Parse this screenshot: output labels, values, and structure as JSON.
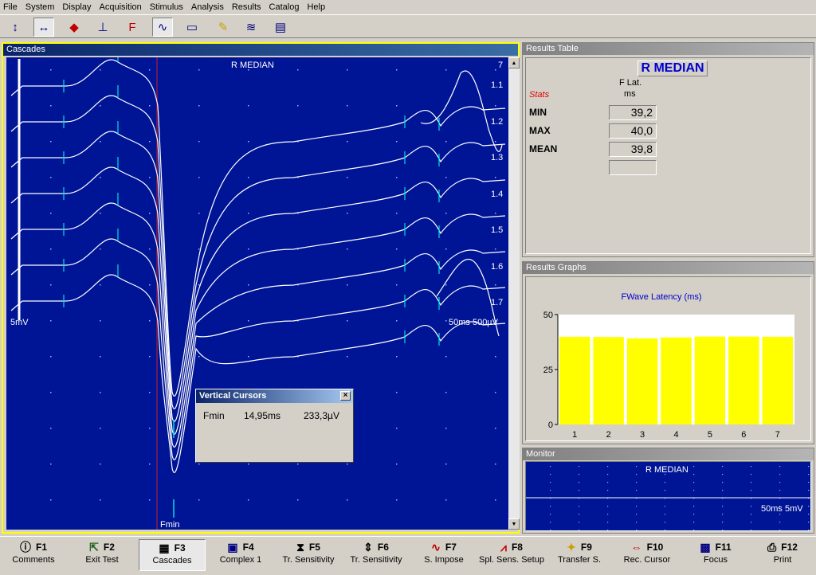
{
  "menu": [
    "File",
    "System",
    "Display",
    "Acquisition",
    "Stimulus",
    "Analysis",
    "Results",
    "Catalog",
    "Help"
  ],
  "menu_underline": [
    0,
    0,
    0,
    0,
    1,
    0,
    0,
    0,
    0
  ],
  "toolbar": [
    {
      "name": "amplitude-cursor-icon",
      "glyph": "↕",
      "pressed": false
    },
    {
      "name": "horizontal-cursor-icon",
      "glyph": "↔",
      "pressed": true
    },
    {
      "name": "latency-marker-icon",
      "glyph": "◆",
      "pressed": false
    },
    {
      "name": "onset-marker-icon",
      "glyph": "⊥",
      "pressed": false
    },
    {
      "name": "f-marker-icon",
      "glyph": "F",
      "pressed": false
    },
    {
      "name": "waveform-icon",
      "glyph": "∿",
      "pressed": true
    },
    {
      "name": "window-icon",
      "glyph": "▭",
      "pressed": false
    },
    {
      "name": "marker-pen-icon",
      "glyph": "✎",
      "pressed": false
    },
    {
      "name": "wave-edit-icon",
      "glyph": "≋",
      "pressed": false
    },
    {
      "name": "report-icon",
      "glyph": "▤",
      "pressed": false
    }
  ],
  "cascades": {
    "title": "Cascades",
    "nerve_label": "R MEDIAN",
    "top_number": "7",
    "sensitivity_label": "5mV",
    "scale_label": "50ms 500µV",
    "cursor_label": "Fmin",
    "trace_labels": [
      "1.1",
      "1.2",
      "1.3",
      "1.4",
      "1.5",
      "1.6",
      "1.7"
    ]
  },
  "vertical_cursors": {
    "title": "Vertical Cursors",
    "close": "×",
    "label": "Fmin",
    "time": "14,95ms",
    "amplitude": "233,3µV"
  },
  "results_table": {
    "title": "Results Table",
    "nerve": "R MEDIAN",
    "col_header_line1": "F Lat.",
    "col_header_line2": "ms",
    "stats_label": "Stats",
    "rows": [
      {
        "label": "MIN",
        "value": "39,2"
      },
      {
        "label": "MAX",
        "value": "40,0"
      },
      {
        "label": "MEAN",
        "value": "39,8"
      },
      {
        "label": "",
        "value": ""
      }
    ]
  },
  "results_graphs": {
    "title": "Results Graphs",
    "chart_title": "FWave Latency (ms)",
    "y_ticks": [
      "50",
      "25",
      "0"
    ],
    "bar_color": "#ffff00"
  },
  "chart_data": {
    "type": "bar",
    "title": "FWave Latency (ms)",
    "categories": [
      "1",
      "2",
      "3",
      "4",
      "5",
      "6",
      "7"
    ],
    "values": [
      39.9,
      39.8,
      39.2,
      39.6,
      40.0,
      40.0,
      39.9
    ],
    "ylim": [
      0,
      50
    ],
    "xlabel": "",
    "ylabel": ""
  },
  "monitor": {
    "title": "Monitor",
    "nerve": "R MEDIAN",
    "scale": "50ms 5mV"
  },
  "fkeys": [
    {
      "key": "F1",
      "label": "Comments",
      "icon": "comment-icon",
      "glyph": "ⓘ",
      "pressed": false
    },
    {
      "key": "F2",
      "label": "Exit Test",
      "icon": "exit-test-icon",
      "glyph": "⇱",
      "pressed": false
    },
    {
      "key": "F3",
      "label": "Cascades",
      "icon": "cascades-icon",
      "glyph": "▦",
      "pressed": true
    },
    {
      "key": "F4",
      "label": "Complex 1",
      "icon": "complex-icon",
      "glyph": "▣",
      "pressed": false
    },
    {
      "key": "F5",
      "label": "Tr. Sensitivity",
      "icon": "sensitivity-up-icon",
      "glyph": "⧗",
      "pressed": false
    },
    {
      "key": "F6",
      "label": "Tr. Sensitivity",
      "icon": "sensitivity-down-icon",
      "glyph": "⇕",
      "pressed": false
    },
    {
      "key": "F7",
      "label": "S. Impose",
      "icon": "superimpose-icon",
      "glyph": "∿",
      "pressed": false
    },
    {
      "key": "F8",
      "label": "Spl. Sens. Setup",
      "icon": "sens-setup-icon",
      "glyph": "⩘",
      "pressed": false
    },
    {
      "key": "F9",
      "label": "Transfer S.",
      "icon": "transfer-icon",
      "glyph": "✦",
      "pressed": false
    },
    {
      "key": "F10",
      "label": "Rec. Cursor",
      "icon": "rec-cursor-icon",
      "glyph": "⇔",
      "pressed": false
    },
    {
      "key": "F11",
      "label": "Focus",
      "icon": "focus-icon",
      "glyph": "▩",
      "pressed": false
    },
    {
      "key": "F12",
      "label": "Print",
      "icon": "print-icon",
      "glyph": "⎙",
      "pressed": false
    }
  ]
}
